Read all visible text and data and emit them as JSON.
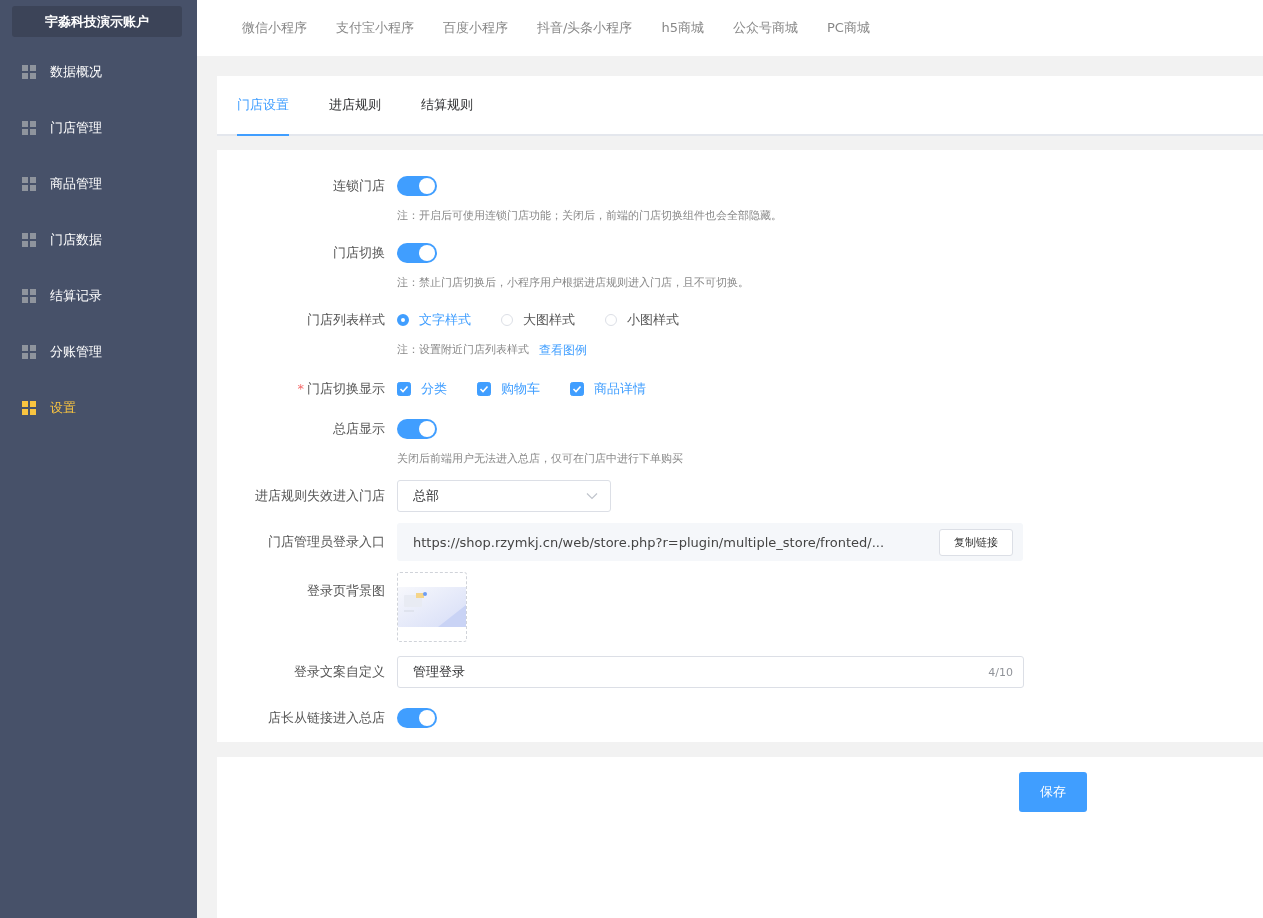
{
  "sidebar": {
    "account": "宇淼科技演示账户",
    "items": [
      {
        "label": "数据概况",
        "selected": false
      },
      {
        "label": "门店管理",
        "selected": false
      },
      {
        "label": "商品管理",
        "selected": false
      },
      {
        "label": "门店数据",
        "selected": false
      },
      {
        "label": "结算记录",
        "selected": false
      },
      {
        "label": "分账管理",
        "selected": false
      },
      {
        "label": "设置",
        "selected": true
      }
    ]
  },
  "platform_tabs": [
    "微信小程序",
    "支付宝小程序",
    "百度小程序",
    "抖音/头条小程序",
    "h5商城",
    "公众号商城",
    "PC商城"
  ],
  "tabs": [
    {
      "label": "门店设置",
      "selected": true
    },
    {
      "label": "进店规则",
      "selected": false
    },
    {
      "label": "结算规则",
      "selected": false
    }
  ],
  "form": [
    {
      "kind": "switch",
      "label": "连锁门店",
      "on": true,
      "note": "注：开启后可使用连锁门店功能；关闭后，前端的门店切换组件也会全部隐藏。"
    },
    {
      "kind": "switch",
      "label": "门店切换",
      "on": true,
      "note": "注：禁止门店切换后，小程序用户根据进店规则进入门店，且不可切换。"
    },
    {
      "kind": "radio",
      "label": "门店列表样式",
      "options": [
        {
          "label": "文字样式",
          "selected": true
        },
        {
          "label": "大图样式",
          "selected": false
        },
        {
          "label": "小图样式",
          "selected": false
        }
      ],
      "note": "注：设置附近门店列表样式",
      "link": "查看图例"
    },
    {
      "kind": "checkbox",
      "label": "门店切换显示",
      "required_mark": "*",
      "options": [
        {
          "label": "分类",
          "checked": true
        },
        {
          "label": "购物车",
          "checked": true
        },
        {
          "label": "商品详情",
          "checked": true
        }
      ]
    },
    {
      "kind": "switch",
      "label": "总店显示",
      "on": true,
      "note": "关闭后前端用户无法进入总店，仅可在门店中进行下单购买"
    },
    {
      "kind": "select",
      "label": "进店规则失效进入门店",
      "value": "总部"
    },
    {
      "kind": "link",
      "label": "门店管理员登录入口",
      "value": "https://shop.rzymkj.cn/web/store.php?r=plugin/multiple_store/fronted/...",
      "button": "复制链接"
    },
    {
      "label": "登录页背景图"
    },
    {
      "kind": "text",
      "label": "登录文案自定义",
      "value": "管理登录",
      "count": "4/10"
    },
    {
      "kind": "switch",
      "label": "店长从链接进入总店",
      "on": true
    }
  ],
  "save_button": "保存"
}
